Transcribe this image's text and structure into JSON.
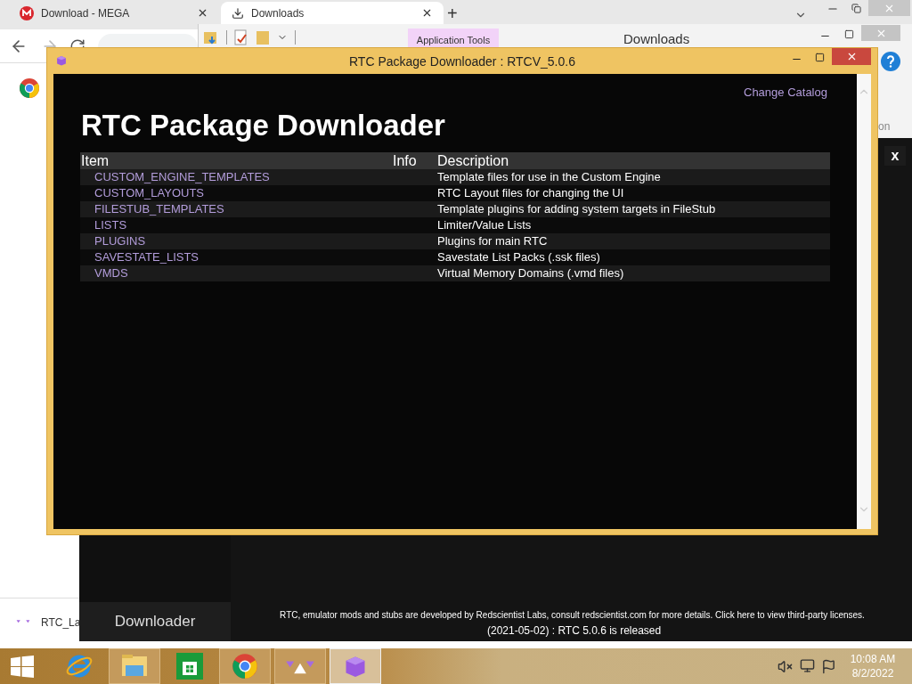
{
  "browser": {
    "tabs": [
      {
        "title": "Download - MEGA",
        "selected": false
      },
      {
        "title": "Downloads",
        "selected": true
      }
    ],
    "new_tab": "+",
    "download_item": "RTC_La"
  },
  "explorer": {
    "ribbon_tab": "Application Tools",
    "title": "Downloads",
    "cut_text": "on"
  },
  "rtc_app": {
    "close": "x",
    "nav": [
      {
        "label": "Downloader",
        "selected": true
      }
    ],
    "credits": "RTC, emulator mods and stubs are developed by Redscientist Labs, consult redscientist.com for more details. Click here to view third-party licenses.",
    "news": "(2021-05-02) : RTC 5.0.6 is released"
  },
  "dialog": {
    "title": "RTC Package Downloader : RTCV_5.0.6",
    "link": "Change Catalog",
    "heading": "RTC Package Downloader",
    "table": {
      "columns": [
        "Item",
        "Info",
        "Description"
      ],
      "rows": [
        {
          "item": "CUSTOM_ENGINE_TEMPLATES",
          "description": "Template files for use in the Custom Engine"
        },
        {
          "item": "CUSTOM_LAYOUTS",
          "description": "RTC Layout files for changing the UI"
        },
        {
          "item": "FILESTUB_TEMPLATES",
          "description": "Template plugins for adding system targets in FileStub"
        },
        {
          "item": "LISTS",
          "description": "Limiter/Value Lists"
        },
        {
          "item": "PLUGINS",
          "description": "Plugins for main RTC"
        },
        {
          "item": "SAVESTATE_LISTS",
          "description": "Savestate List Packs (.ssk files)"
        },
        {
          "item": "VMDS",
          "description": "Virtual Memory Domains (.vmd files)"
        }
      ]
    }
  },
  "taskbar": {
    "apps": [
      {
        "kind": "ie",
        "open": false,
        "selected": false
      },
      {
        "kind": "explorer",
        "open": true,
        "selected": false
      },
      {
        "kind": "store",
        "open": false,
        "selected": false
      },
      {
        "kind": "chrome",
        "open": true,
        "selected": false
      },
      {
        "kind": "launcher",
        "open": true,
        "selected": false
      },
      {
        "kind": "cube",
        "open": true,
        "selected": true
      }
    ],
    "time": "10:08 AM",
    "date": "8/2/2022"
  }
}
